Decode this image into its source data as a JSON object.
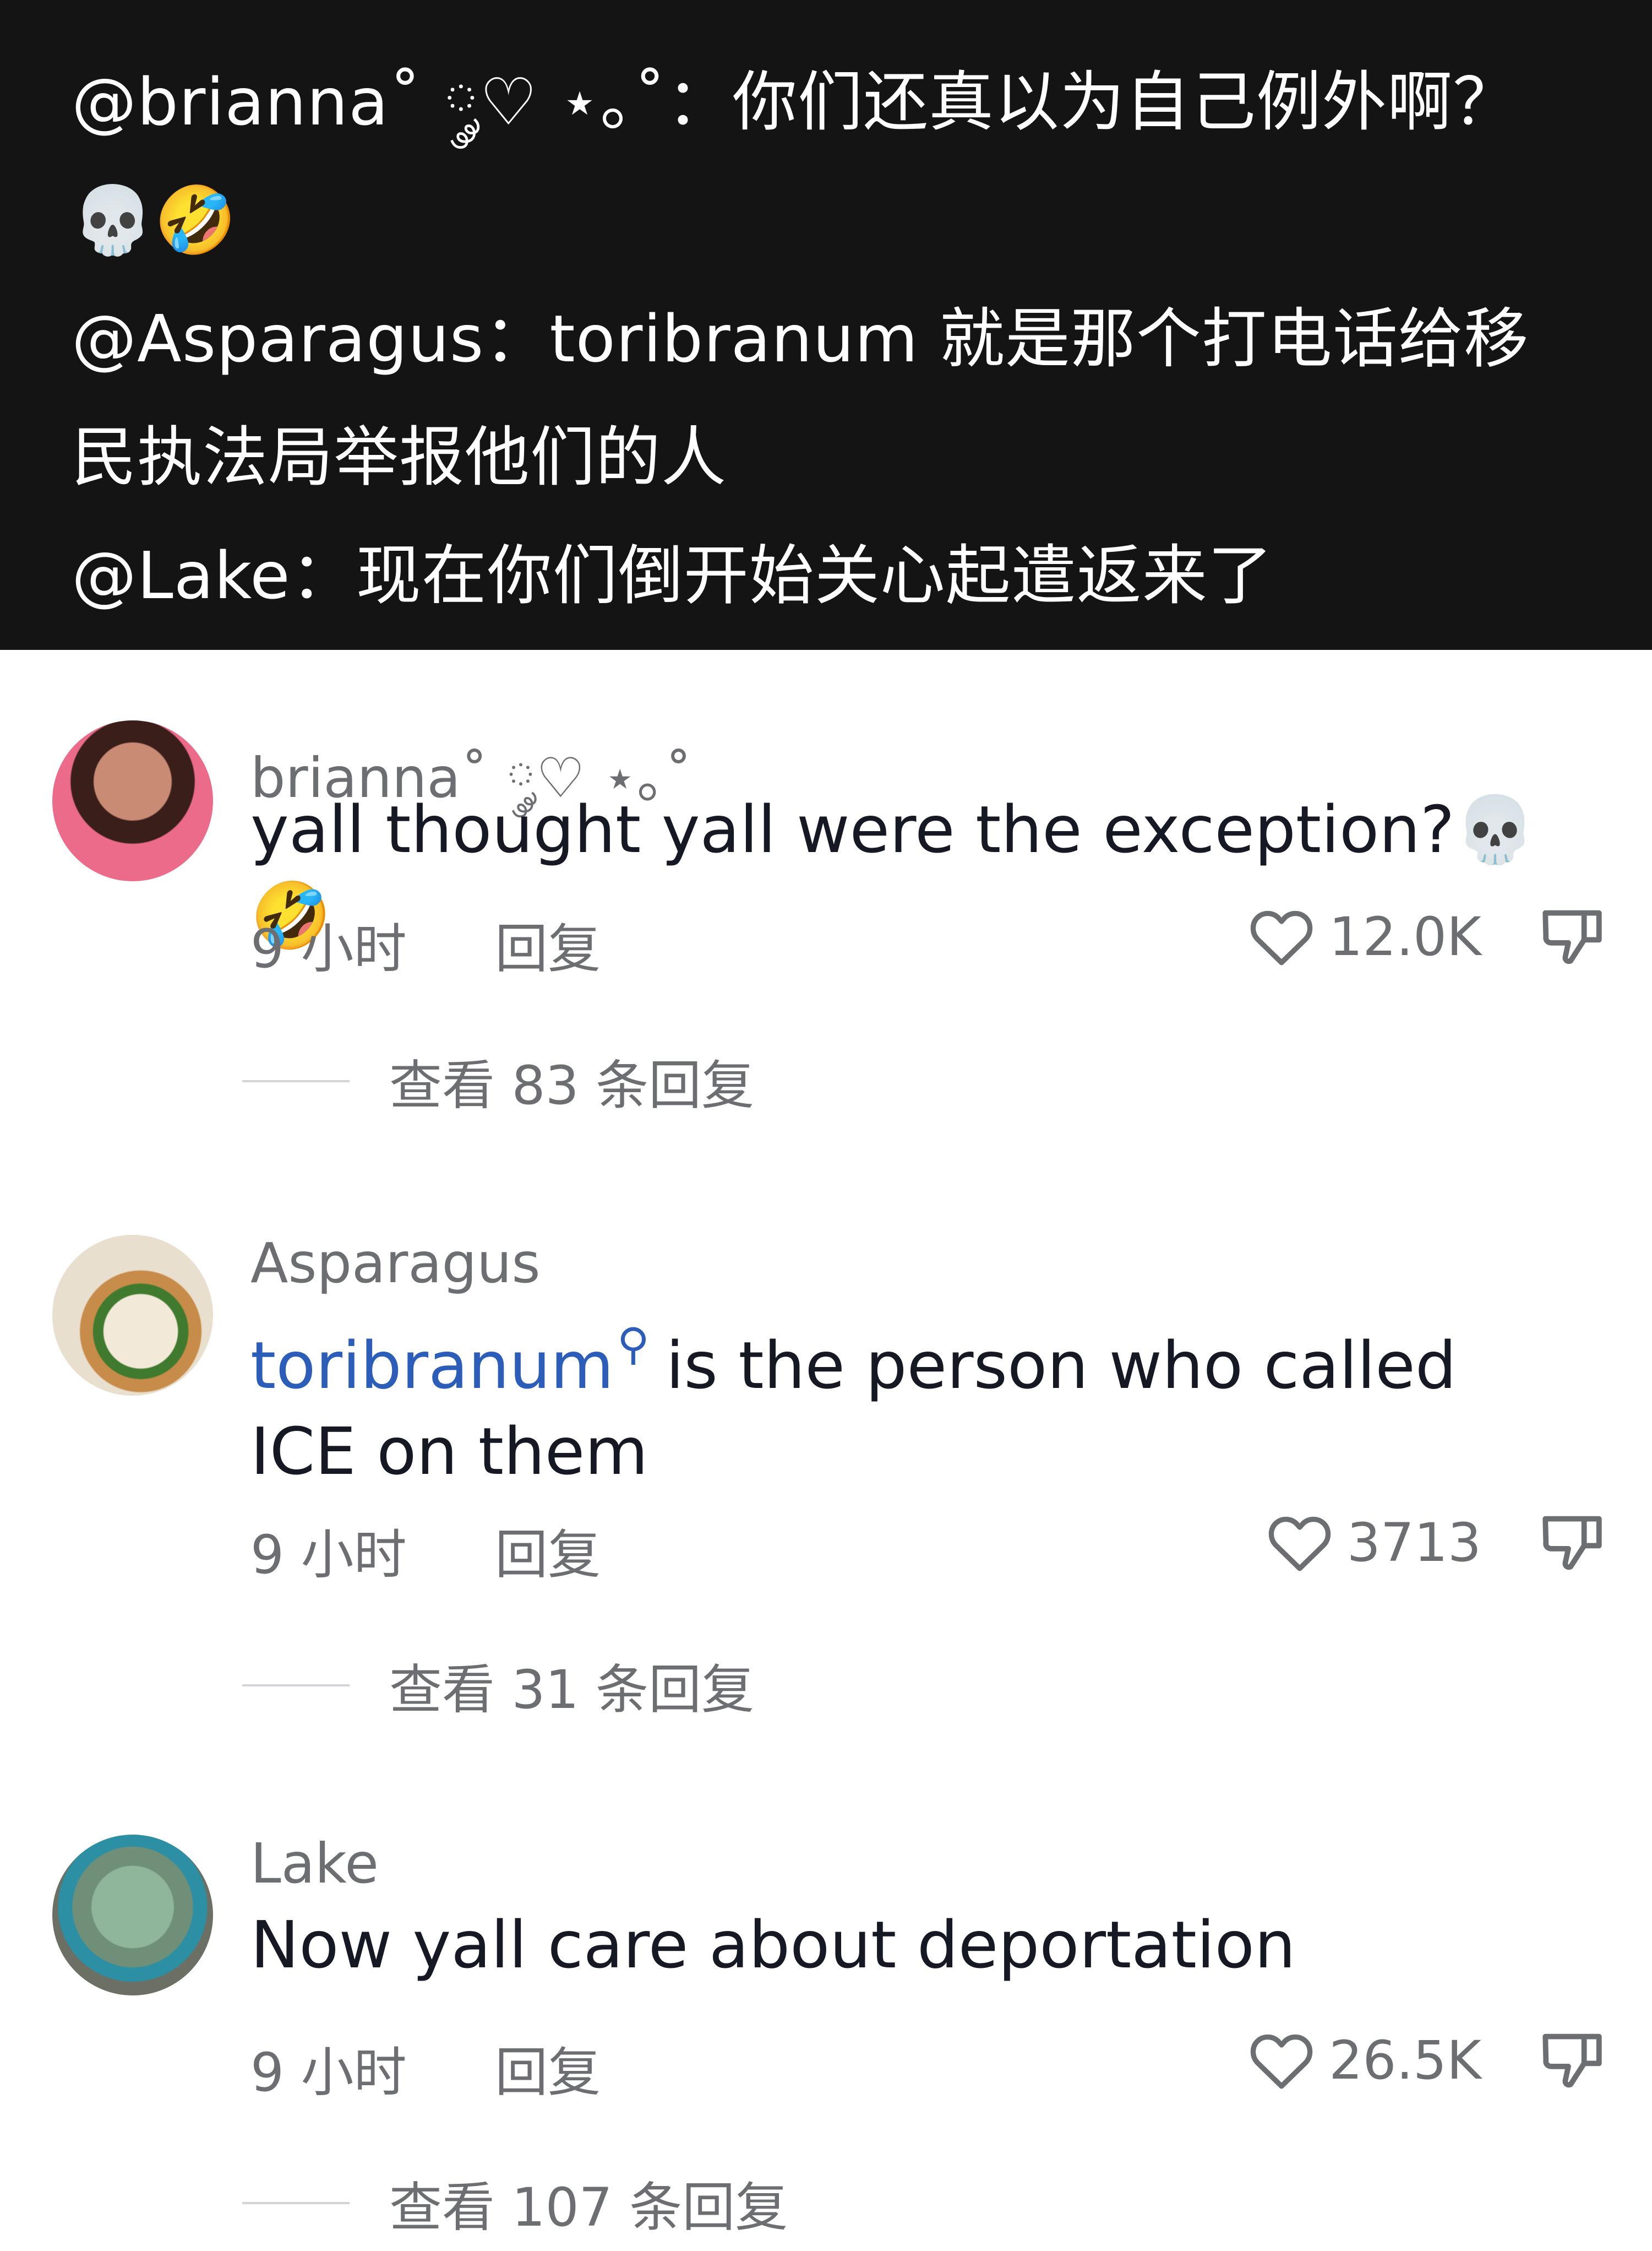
{
  "caption": {
    "line1": "@brianna˚ ༘♡ ⋆｡˚：你们还真以为自己例外啊？",
    "line2": "💀🤣",
    "line3": "@Asparagus：toribranum 就是那个打电话给移",
    "line4": "民执法局举报他们的人",
    "line5": "@Lake：现在你们倒开始关心起遣返来了"
  },
  "comments": [
    {
      "username": "brianna˚ ༘♡ ⋆｡˚",
      "text": "yall thought yall were the exception?💀🤣",
      "time": "9 小时",
      "reply": "回复",
      "likes": "12.0K",
      "view_replies": "查看 83 条回复"
    },
    {
      "username": "Asparagus",
      "mention": "toribranum",
      "text": "is the person who called ICE on them",
      "time": "9 小时",
      "reply": "回复",
      "likes": "3713",
      "view_replies": "查看 31 条回复"
    },
    {
      "username": "Lake",
      "text": "Now yall care about deportation",
      "time": "9 小时",
      "reply": "回复",
      "likes": "26.5K",
      "view_replies": "查看 107 条回复"
    }
  ],
  "icons": {
    "like": "heart-outline-icon",
    "dislike": "thumbs-down-icon",
    "mention": "search-icon"
  },
  "colors": {
    "caption_bg": "#141414",
    "mention": "#2b5db9",
    "meta": "#6d6e72"
  }
}
